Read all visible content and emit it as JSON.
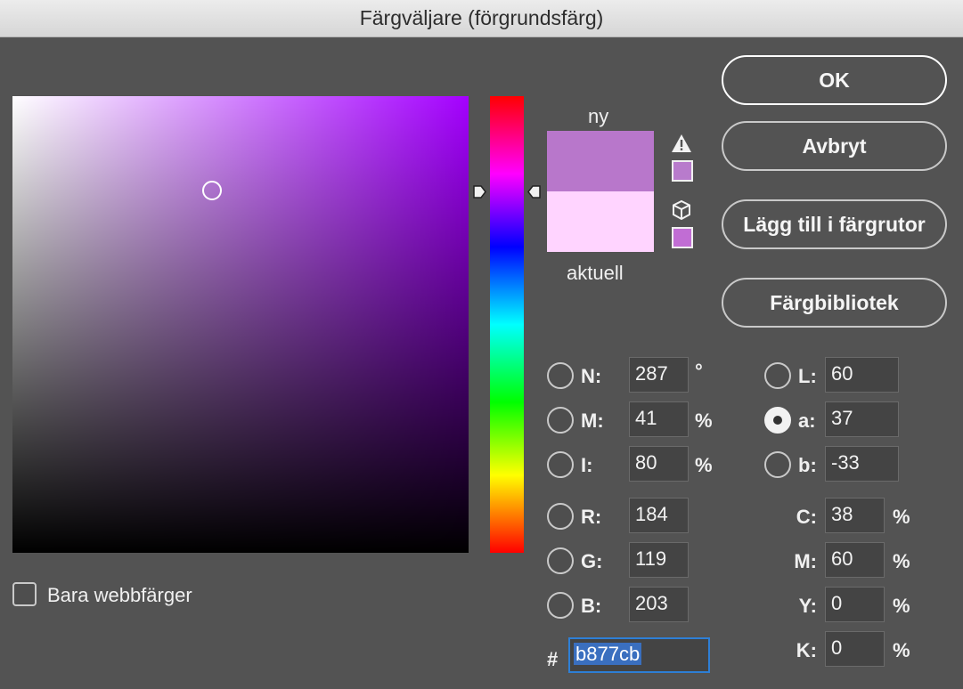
{
  "window": {
    "title": "Färgväljare (förgrundsfärg)"
  },
  "colors": {
    "field_hue": "#a400ff",
    "new": "#b877cb",
    "current": "#ffd4ff",
    "gamut_swatch": "#b87bcc",
    "web_swatch": "#c16dd4",
    "hex_highlight": "#3a6fbf"
  },
  "swatches": {
    "new_label": "ny",
    "current_label": "aktuell"
  },
  "buttons": {
    "ok": "OK",
    "cancel": "Avbryt",
    "add_to_swatches": "Lägg till i färgrutor",
    "color_libraries": "Färgbibliotek"
  },
  "hsb": [
    {
      "label": "N:",
      "value": "287",
      "unit": "°",
      "selected": false
    },
    {
      "label": "M:",
      "value": "41",
      "unit": "%",
      "selected": false
    },
    {
      "label": "I:",
      "value": "80",
      "unit": "%",
      "selected": false
    }
  ],
  "lab": [
    {
      "label": "L:",
      "value": "60",
      "selected": false
    },
    {
      "label": "a:",
      "value": "37",
      "selected": true
    },
    {
      "label": "b:",
      "value": "-33",
      "selected": false
    }
  ],
  "rgb": [
    {
      "label": "R:",
      "value": "184",
      "selected": false
    },
    {
      "label": "G:",
      "value": "119",
      "selected": false
    },
    {
      "label": "B:",
      "value": "203",
      "selected": false
    }
  ],
  "cmyk": [
    {
      "label": "C:",
      "value": "38",
      "unit": "%"
    },
    {
      "label": "M:",
      "value": "60",
      "unit": "%"
    },
    {
      "label": "Y:",
      "value": "0",
      "unit": "%"
    },
    {
      "label": "K:",
      "value": "0",
      "unit": "%"
    }
  ],
  "hex": {
    "prefix": "#",
    "value": "b877cb"
  },
  "web_only": {
    "label": "Bara webbfärger",
    "checked": false
  },
  "icons": {
    "gamut_warning": "warning-triangle-icon",
    "web_safe": "cube-icon",
    "hue_slider_arrows": "slider-arrow-icon"
  }
}
